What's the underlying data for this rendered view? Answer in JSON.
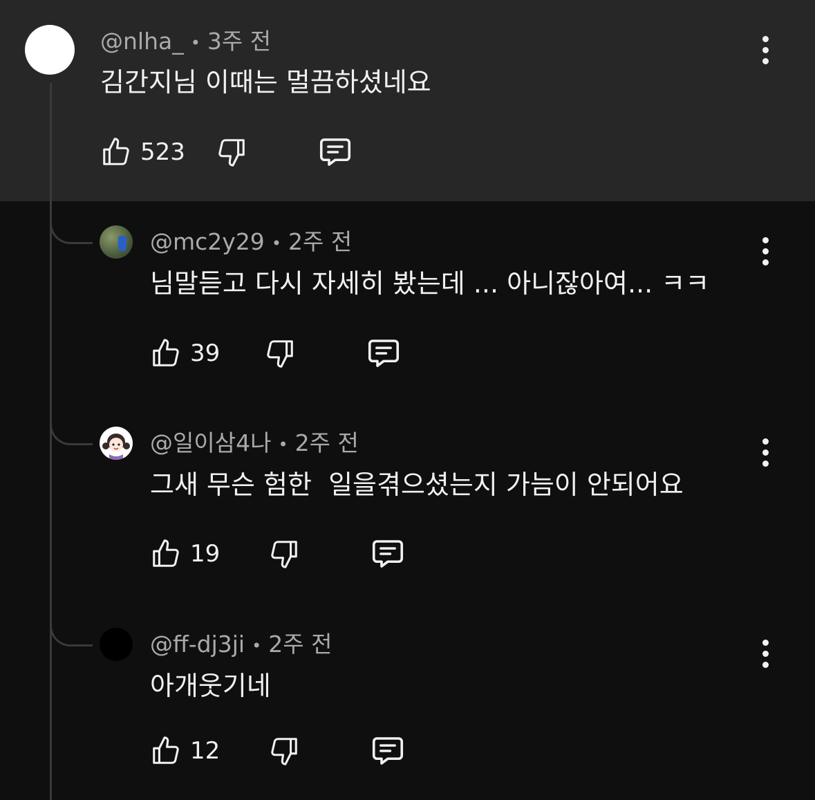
{
  "comments": [
    {
      "handle": "@nlha_",
      "time": "3주 전",
      "text": "김간지님 이때는 멀끔하셨네요",
      "likes": "523"
    },
    {
      "handle": "@mc2y29",
      "time": "2주 전",
      "text": "님말듣고 다시 자세히 봤는데 ... 아니잖아여... ㅋㅋ",
      "likes": "39"
    },
    {
      "handle": "@일이삼4나",
      "time": "2주 전",
      "text": "그새 무슨 험한  일을겪으셨는지 가늠이 안되어요",
      "likes": "19"
    },
    {
      "handle": "@ff-dj3ji",
      "time": "2주 전",
      "text": "아개웃기네",
      "likes": "12"
    }
  ],
  "meta_separator": "•",
  "colors": {
    "parent_bg": "#272727",
    "page_bg": "#0f0f0f",
    "text": "#f1f1f1",
    "secondary": "#aaaaaa"
  }
}
